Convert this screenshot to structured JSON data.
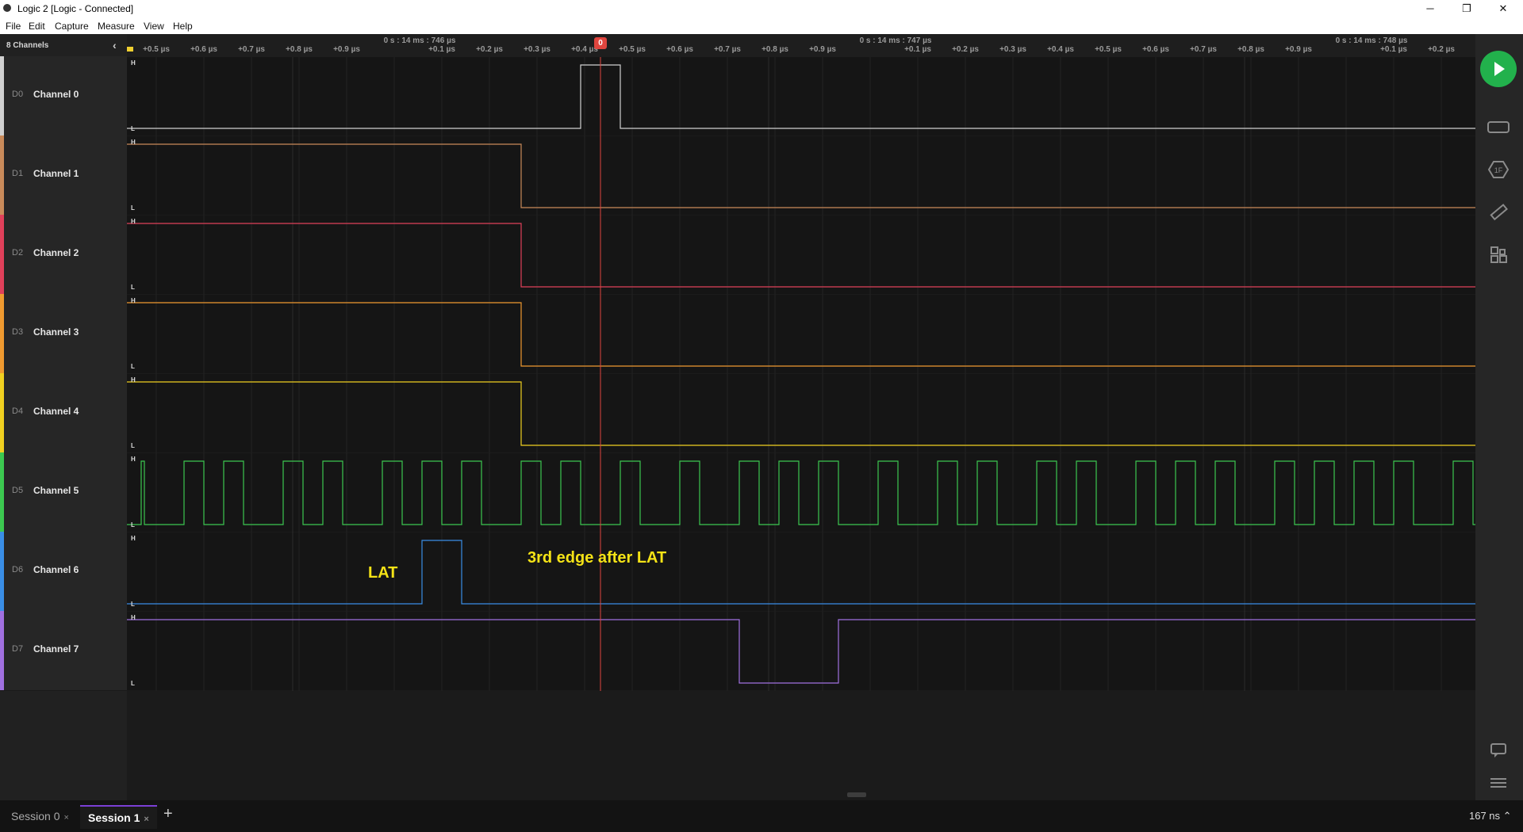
{
  "window": {
    "title": "Logic 2 [Logic - Connected]",
    "minimize": "─",
    "maximize": "❐",
    "close": "✕"
  },
  "menu": {
    "items": [
      "File",
      "Edit",
      "Capture",
      "Measure",
      "View",
      "Help"
    ]
  },
  "sidebar": {
    "header": "8 Channels",
    "channels": [
      {
        "label": "D0",
        "name": "Channel 0",
        "color": "#d0d0d0"
      },
      {
        "label": "D1",
        "name": "Channel 1",
        "color": "#c98a5a"
      },
      {
        "label": "D2",
        "name": "Channel 2",
        "color": "#e0405a"
      },
      {
        "label": "D3",
        "name": "Channel 3",
        "color": "#f09a30"
      },
      {
        "label": "D4",
        "name": "Channel 4",
        "color": "#f0d020"
      },
      {
        "label": "D5",
        "name": "Channel 5",
        "color": "#3cc850"
      },
      {
        "label": "D6",
        "name": "Channel 6",
        "color": "#3a8ee6"
      },
      {
        "label": "D7",
        "name": "Channel 7",
        "color": "#a070e0"
      }
    ]
  },
  "ruler": {
    "major": [
      "0 s : 14 ms : 746 µs",
      "0 s : 14 ms : 747 µs",
      "0 s : 14 ms : 748 µs"
    ],
    "ticks": [
      "+0.5 µs",
      "+0.6 µs",
      "+0.7 µs",
      "+0.8 µs",
      "+0.9 µs",
      "+0.1 µs",
      "+0.2 µs",
      "+0.3 µs",
      "+0.4 µs",
      "+0.5 µs",
      "+0.6 µs",
      "+0.7 µs",
      "+0.8 µs",
      "+0.9 µs",
      "+0.1 µs",
      "+0.2 µs",
      "+0.3 µs",
      "+0.4 µs",
      "+0.5 µs",
      "+0.6 µs",
      "+0.7 µs",
      "+0.8 µs",
      "+0.9 µs",
      "+0.1 µs",
      "+0.2 µs"
    ],
    "marker": "0"
  },
  "levels": {
    "high": "H",
    "low": "L"
  },
  "annotations": {
    "lat": "LAT",
    "edge": "3rd edge after LAT"
  },
  "tabs": [
    {
      "label": "Session 0",
      "close": "×"
    },
    {
      "label": "Session 1",
      "close": "×"
    }
  ],
  "add_tab": "+",
  "status": {
    "time_per_division": "167 ns ⌃"
  },
  "colors": {
    "accent": "#7b3fd6",
    "play": "#22b14c",
    "cursor": "#e0453e",
    "annotation": "#f5e316"
  }
}
